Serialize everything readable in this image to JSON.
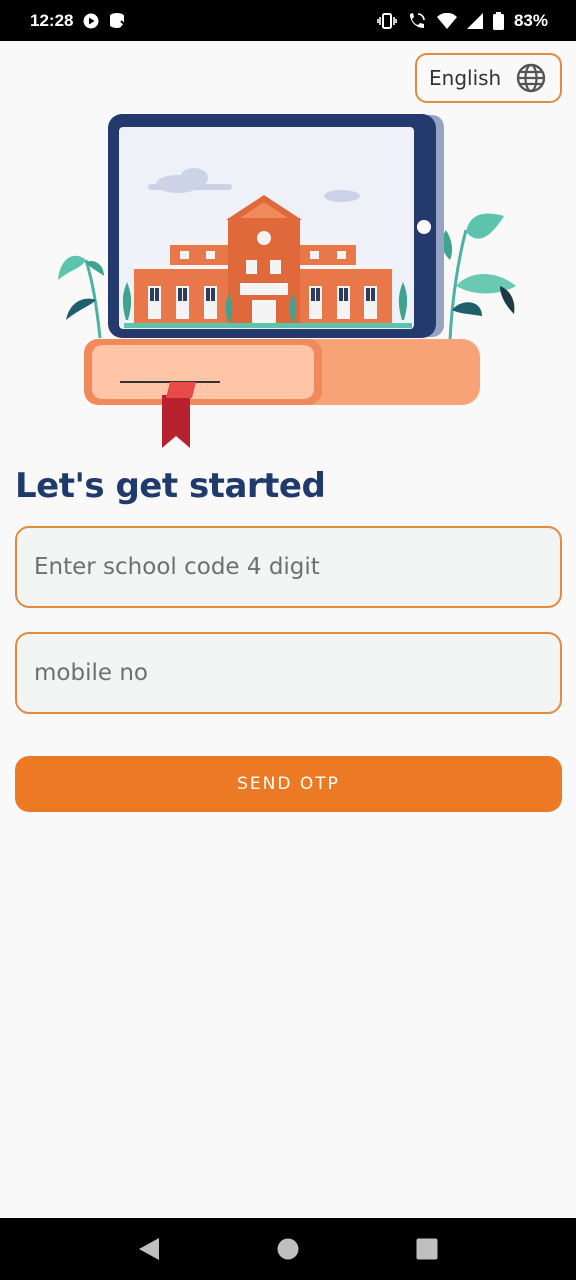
{
  "status_bar": {
    "time": "12:28",
    "battery": "83%",
    "icons": [
      "play-icon",
      "data-saver-icon",
      "vibrate-icon",
      "wifi-call-icon",
      "wifi-icon",
      "signal-icon",
      "battery-icon"
    ]
  },
  "language": {
    "label": "English",
    "icon": "globe-icon"
  },
  "heading": "Let's get started",
  "form": {
    "school_code_placeholder": "Enter school code 4 digit",
    "mobile_placeholder": "mobile no",
    "send_label": "SEND OTP"
  },
  "nav": {
    "icons": [
      "back-icon",
      "home-icon",
      "recents-icon"
    ]
  },
  "colors": {
    "accent": "#ec7a24",
    "border": "#e38b3d",
    "heading": "#1f3a6b",
    "tablet": "#243a6e"
  }
}
